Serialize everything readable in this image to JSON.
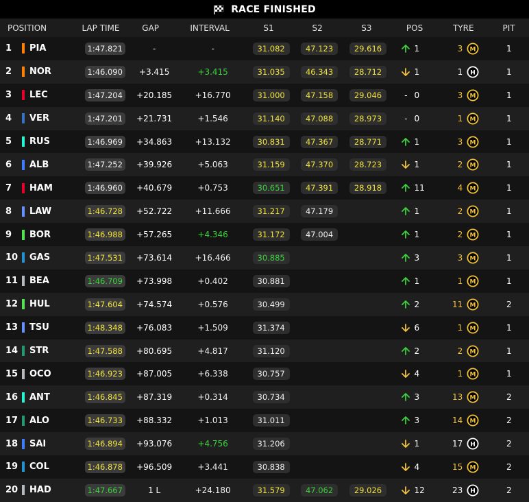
{
  "header": {
    "title": "RACE FINISHED",
    "icon": "checkered-flag-icon"
  },
  "columns": {
    "position": "POSITION",
    "lap_time": "LAP TIME",
    "gap": "GAP",
    "interval": "INTERVAL",
    "s1": "S1",
    "s2": "S2",
    "s3": "S3",
    "pos": "POS",
    "tyre": "TYRE",
    "pit": "PIT"
  },
  "colors": {
    "sector_yellow": "#f1e23c",
    "sector_green": "#3bd33b",
    "arrow_up": "#3bd33b",
    "arrow_down": "#f2c33a",
    "tyre_medium": "#f2c33a",
    "tyre_hard": "#ffffff"
  },
  "rows": [
    {
      "pos": "1",
      "team_color": "#ff8000",
      "driver": "PIA",
      "lap": "1:47.821",
      "lap_color": "white",
      "gap": "-",
      "interval": "-",
      "interval_color": "white",
      "s1": "31.082",
      "s1_color": "yellow",
      "s2": "47.123",
      "s2_color": "yellow",
      "s3": "29.616",
      "s3_color": "yellow",
      "dir": "up",
      "change": "1",
      "tyre_age": "3",
      "tyre_new": true,
      "tyre": "M",
      "pit": "1"
    },
    {
      "pos": "2",
      "team_color": "#ff8000",
      "driver": "NOR",
      "lap": "1:46.090",
      "lap_color": "white",
      "gap": "+3.415",
      "interval": "+3.415",
      "interval_color": "green",
      "s1": "31.035",
      "s1_color": "yellow",
      "s2": "46.343",
      "s2_color": "yellow",
      "s3": "28.712",
      "s3_color": "yellow",
      "dir": "down",
      "change": "1",
      "tyre_age": "1",
      "tyre_new": false,
      "tyre": "H",
      "pit": "1"
    },
    {
      "pos": "3",
      "team_color": "#e8002d",
      "driver": "LEC",
      "lap": "1:47.204",
      "lap_color": "white",
      "gap": "+20.185",
      "interval": "+16.770",
      "interval_color": "white",
      "s1": "31.000",
      "s1_color": "yellow",
      "s2": "47.158",
      "s2_color": "yellow",
      "s3": "29.046",
      "s3_color": "yellow",
      "dir": "none",
      "change": "0",
      "tyre_age": "3",
      "tyre_new": true,
      "tyre": "M",
      "pit": "1"
    },
    {
      "pos": "4",
      "team_color": "#3671c6",
      "driver": "VER",
      "lap": "1:47.201",
      "lap_color": "white",
      "gap": "+21.731",
      "interval": "+1.546",
      "interval_color": "white",
      "s1": "31.140",
      "s1_color": "yellow",
      "s2": "47.088",
      "s2_color": "yellow",
      "s3": "28.973",
      "s3_color": "yellow",
      "dir": "none",
      "change": "0",
      "tyre_age": "1",
      "tyre_new": true,
      "tyre": "M",
      "pit": "1"
    },
    {
      "pos": "5",
      "team_color": "#27f4d2",
      "driver": "RUS",
      "lap": "1:46.969",
      "lap_color": "white",
      "gap": "+34.863",
      "interval": "+13.132",
      "interval_color": "white",
      "s1": "30.831",
      "s1_color": "yellow",
      "s2": "47.367",
      "s2_color": "yellow",
      "s3": "28.771",
      "s3_color": "yellow",
      "dir": "up",
      "change": "1",
      "tyre_age": "3",
      "tyre_new": true,
      "tyre": "M",
      "pit": "1"
    },
    {
      "pos": "6",
      "team_color": "#3f7fff",
      "driver": "ALB",
      "lap": "1:47.252",
      "lap_color": "white",
      "gap": "+39.926",
      "interval": "+5.063",
      "interval_color": "white",
      "s1": "31.159",
      "s1_color": "yellow",
      "s2": "47.370",
      "s2_color": "yellow",
      "s3": "28.723",
      "s3_color": "yellow",
      "dir": "down",
      "change": "1",
      "tyre_age": "2",
      "tyre_new": true,
      "tyre": "M",
      "pit": "1"
    },
    {
      "pos": "7",
      "team_color": "#e8002d",
      "driver": "HAM",
      "lap": "1:46.960",
      "lap_color": "white",
      "gap": "+40.679",
      "interval": "+0.753",
      "interval_color": "white",
      "s1": "30.651",
      "s1_color": "green",
      "s2": "47.391",
      "s2_color": "yellow",
      "s3": "28.918",
      "s3_color": "yellow",
      "dir": "up",
      "change": "11",
      "tyre_age": "4",
      "tyre_new": true,
      "tyre": "M",
      "pit": "1"
    },
    {
      "pos": "8",
      "team_color": "#6692ff",
      "driver": "LAW",
      "lap": "1:46.728",
      "lap_color": "yellow",
      "gap": "+52.722",
      "interval": "+11.666",
      "interval_color": "white",
      "s1": "31.217",
      "s1_color": "yellow",
      "s2": "47.179",
      "s2_color": "white",
      "s3": "",
      "s3_color": "white",
      "dir": "up",
      "change": "1",
      "tyre_age": "2",
      "tyre_new": true,
      "tyre": "M",
      "pit": "1"
    },
    {
      "pos": "9",
      "team_color": "#52e252",
      "driver": "BOR",
      "lap": "1:46.988",
      "lap_color": "yellow",
      "gap": "+57.265",
      "interval": "+4.346",
      "interval_color": "green",
      "s1": "31.172",
      "s1_color": "yellow",
      "s2": "47.004",
      "s2_color": "white",
      "s3": "",
      "s3_color": "white",
      "dir": "up",
      "change": "1",
      "tyre_age": "2",
      "tyre_new": true,
      "tyre": "M",
      "pit": "1"
    },
    {
      "pos": "10",
      "team_color": "#2293d1",
      "driver": "GAS",
      "lap": "1:47.531",
      "lap_color": "yellow",
      "gap": "+73.614",
      "interval": "+16.466",
      "interval_color": "white",
      "s1": "30.885",
      "s1_color": "green",
      "s2": "",
      "s2_color": "white",
      "s3": "",
      "s3_color": "white",
      "dir": "up",
      "change": "3",
      "tyre_age": "3",
      "tyre_new": true,
      "tyre": "M",
      "pit": "1"
    },
    {
      "pos": "11",
      "team_color": "#b6babd",
      "driver": "BEA",
      "lap": "1:46.709",
      "lap_color": "green",
      "gap": "+73.998",
      "interval": "+0.402",
      "interval_color": "white",
      "s1": "30.881",
      "s1_color": "white",
      "s2": "",
      "s2_color": "white",
      "s3": "",
      "s3_color": "white",
      "dir": "up",
      "change": "1",
      "tyre_age": "1",
      "tyre_new": true,
      "tyre": "M",
      "pit": "1"
    },
    {
      "pos": "12",
      "team_color": "#52e252",
      "driver": "HUL",
      "lap": "1:47.604",
      "lap_color": "yellow",
      "gap": "+74.574",
      "interval": "+0.576",
      "interval_color": "white",
      "s1": "30.499",
      "s1_color": "white",
      "s2": "",
      "s2_color": "white",
      "s3": "",
      "s3_color": "white",
      "dir": "up",
      "change": "2",
      "tyre_age": "11",
      "tyre_new": true,
      "tyre": "M",
      "pit": "2"
    },
    {
      "pos": "13",
      "team_color": "#6692ff",
      "driver": "TSU",
      "lap": "1:48.348",
      "lap_color": "yellow",
      "gap": "+76.083",
      "interval": "+1.509",
      "interval_color": "white",
      "s1": "31.374",
      "s1_color": "white",
      "s2": "",
      "s2_color": "white",
      "s3": "",
      "s3_color": "white",
      "dir": "down",
      "change": "6",
      "tyre_age": "1",
      "tyre_new": true,
      "tyre": "M",
      "pit": "1"
    },
    {
      "pos": "14",
      "team_color": "#229971",
      "driver": "STR",
      "lap": "1:47.588",
      "lap_color": "yellow",
      "gap": "+80.695",
      "interval": "+4.817",
      "interval_color": "white",
      "s1": "31.120",
      "s1_color": "white",
      "s2": "",
      "s2_color": "white",
      "s3": "",
      "s3_color": "white",
      "dir": "up",
      "change": "2",
      "tyre_age": "2",
      "tyre_new": true,
      "tyre": "M",
      "pit": "1"
    },
    {
      "pos": "15",
      "team_color": "#b6babd",
      "driver": "OCO",
      "lap": "1:46.923",
      "lap_color": "yellow",
      "gap": "+87.005",
      "interval": "+6.338",
      "interval_color": "white",
      "s1": "30.757",
      "s1_color": "white",
      "s2": "",
      "s2_color": "white",
      "s3": "",
      "s3_color": "white",
      "dir": "down",
      "change": "4",
      "tyre_age": "1",
      "tyre_new": true,
      "tyre": "M",
      "pit": "1"
    },
    {
      "pos": "16",
      "team_color": "#27f4d2",
      "driver": "ANT",
      "lap": "1:46.845",
      "lap_color": "yellow",
      "gap": "+87.319",
      "interval": "+0.314",
      "interval_color": "white",
      "s1": "30.734",
      "s1_color": "white",
      "s2": "",
      "s2_color": "white",
      "s3": "",
      "s3_color": "white",
      "dir": "up",
      "change": "3",
      "tyre_age": "13",
      "tyre_new": true,
      "tyre": "M",
      "pit": "2"
    },
    {
      "pos": "17",
      "team_color": "#229971",
      "driver": "ALO",
      "lap": "1:46.733",
      "lap_color": "yellow",
      "gap": "+88.332",
      "interval": "+1.013",
      "interval_color": "white",
      "s1": "31.011",
      "s1_color": "white",
      "s2": "",
      "s2_color": "white",
      "s3": "",
      "s3_color": "white",
      "dir": "up",
      "change": "3",
      "tyre_age": "14",
      "tyre_new": true,
      "tyre": "M",
      "pit": "2"
    },
    {
      "pos": "18",
      "team_color": "#3f7fff",
      "driver": "SAI",
      "lap": "1:46.894",
      "lap_color": "yellow",
      "gap": "+93.076",
      "interval": "+4.756",
      "interval_color": "green",
      "s1": "31.206",
      "s1_color": "white",
      "s2": "",
      "s2_color": "white",
      "s3": "",
      "s3_color": "white",
      "dir": "down",
      "change": "1",
      "tyre_age": "17",
      "tyre_new": false,
      "tyre": "H",
      "pit": "2"
    },
    {
      "pos": "19",
      "team_color": "#2293d1",
      "driver": "COL",
      "lap": "1:46.878",
      "lap_color": "yellow",
      "gap": "+96.509",
      "interval": "+3.441",
      "interval_color": "white",
      "s1": "30.838",
      "s1_color": "white",
      "s2": "",
      "s2_color": "white",
      "s3": "",
      "s3_color": "white",
      "dir": "down",
      "change": "4",
      "tyre_age": "15",
      "tyre_new": true,
      "tyre": "M",
      "pit": "2"
    },
    {
      "pos": "20",
      "team_color": "#b6babd",
      "driver": "HAD",
      "lap": "1:47.667",
      "lap_color": "green",
      "gap": "1 L",
      "interval": "+24.180",
      "interval_color": "white",
      "s1": "31.579",
      "s1_color": "yellow",
      "s2": "47.062",
      "s2_color": "green",
      "s3": "29.026",
      "s3_color": "yellow",
      "dir": "down",
      "change": "12",
      "tyre_age": "23",
      "tyre_new": false,
      "tyre": "H",
      "pit": "2"
    }
  ]
}
